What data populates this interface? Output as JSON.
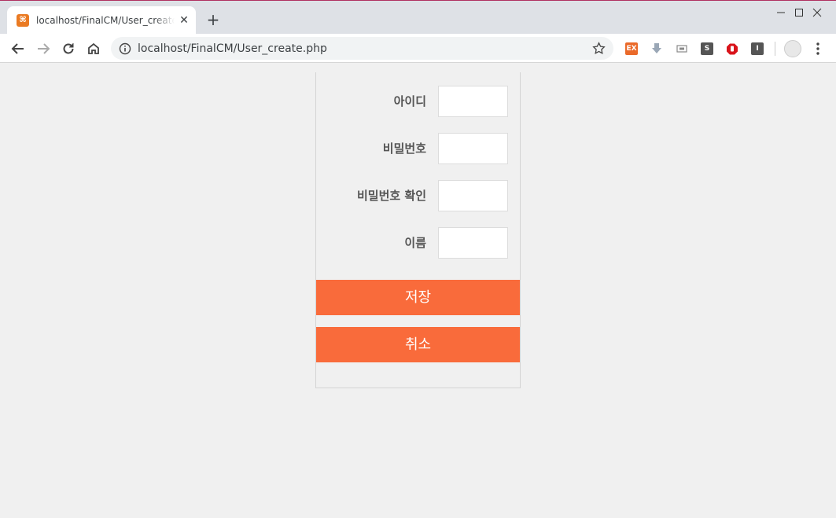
{
  "browser": {
    "tab_title": "localhost/FinalCM/User_create.php",
    "tab_close": "✕",
    "new_tab": "+",
    "url": "localhost/FinalCM/User_create.php",
    "favicon_glyph": "⌘",
    "extensions": [
      {
        "name": "ex-extension-icon",
        "label": "EX",
        "color": "#ea6a2a"
      },
      {
        "name": "download-extension-icon",
        "label": "",
        "color": "#9aa7b6"
      },
      {
        "name": "screen-extension-icon",
        "label": "",
        "color": "#888888"
      },
      {
        "name": "s-extension-icon",
        "label": "S",
        "color": "#555555"
      },
      {
        "name": "adblock-extension-icon",
        "label": "",
        "color": "#d9141b"
      },
      {
        "name": "i-extension-icon",
        "label": "I",
        "color": "#555555"
      }
    ]
  },
  "form": {
    "fields": [
      {
        "label": "아이디",
        "value": ""
      },
      {
        "label": "비밀번호",
        "value": ""
      },
      {
        "label": "비밀번호 확인",
        "value": ""
      },
      {
        "label": "이름",
        "value": ""
      }
    ],
    "save_label": "저장",
    "cancel_label": "취소",
    "accent_color": "#f96b3b"
  }
}
